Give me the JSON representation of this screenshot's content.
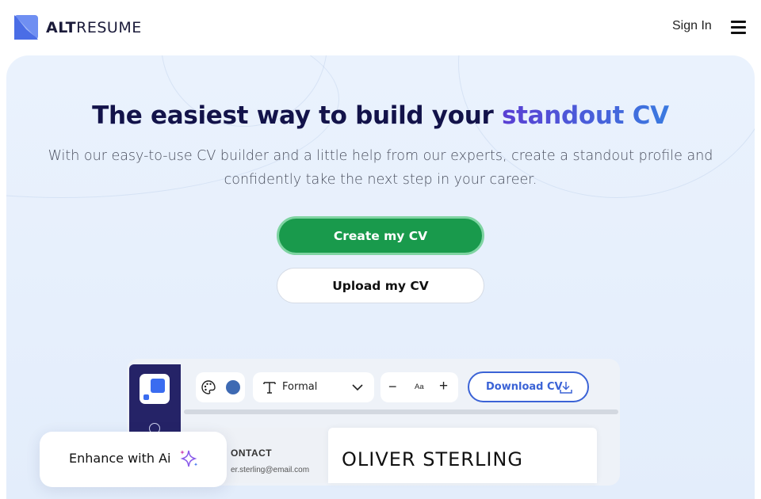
{
  "header": {
    "brand_bold": "ALT",
    "brand_rest": "RESUME",
    "signin_label": "Sign In",
    "menu_icon": "hamburger-icon"
  },
  "hero": {
    "headline_main": "The easiest way to build your ",
    "headline_accent": "standout CV",
    "subtitle": "With our easy-to-use CV builder and a little help from our experts, create a standout profile and confidently take the next step in your career.",
    "create_label": "Create my CV",
    "upload_label": "Upload my CV"
  },
  "editor": {
    "font_style": "Formal",
    "size_label": "Aa",
    "minus_label": "−",
    "plus_label": "+",
    "download_label": "Download CV",
    "contact_heading": "ONTACT",
    "email": "er.sterling@email.com",
    "candidate_name": "OLIVER STERLING"
  },
  "enhance": {
    "label": "Enhance with Ai"
  },
  "colors": {
    "primary_green": "#199a4c",
    "navy": "#13134a",
    "accent_blue": "#3b63d6",
    "sidebar_navy": "#252367",
    "swatch": "#3e6ab3"
  }
}
